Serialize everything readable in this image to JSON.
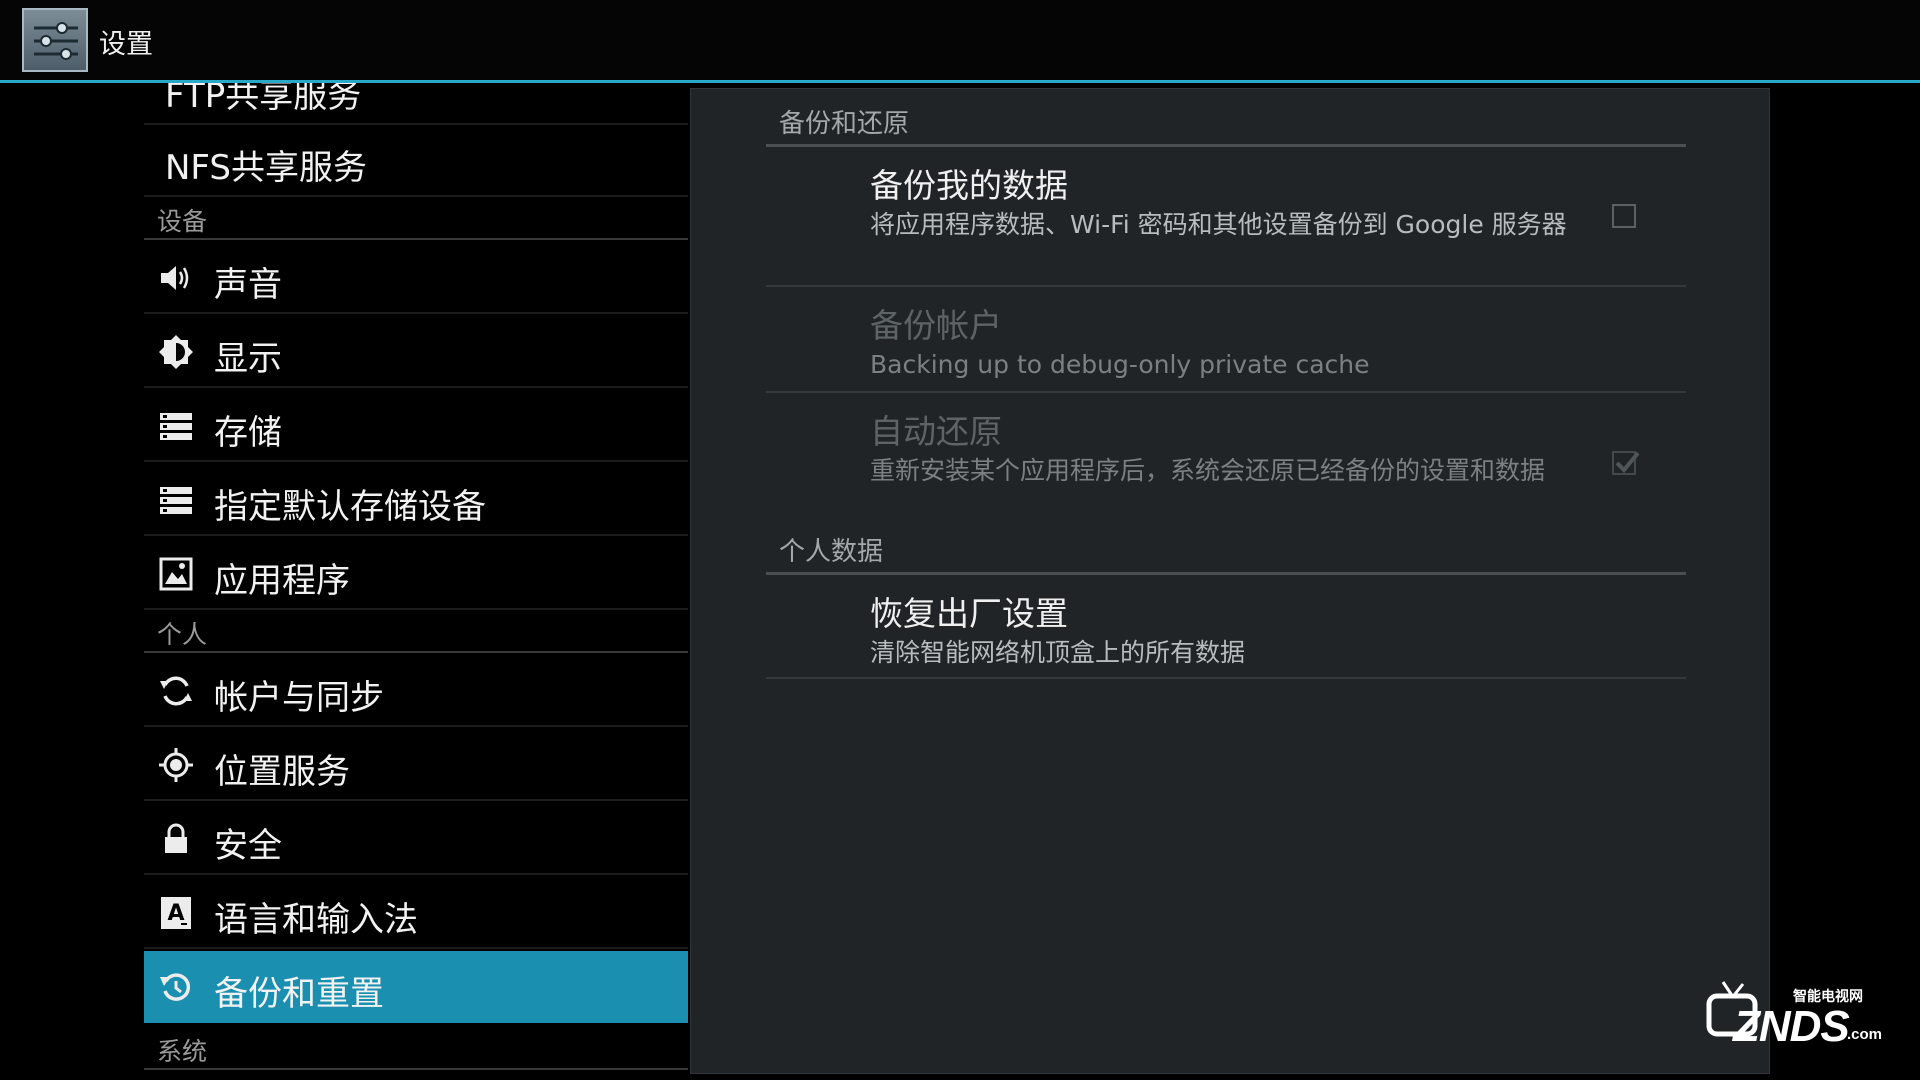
{
  "actionbar": {
    "title": "设置",
    "app_icon": "settings-sliders-icon"
  },
  "sidebar": {
    "rows": [
      {
        "type": "item",
        "label": "FTP共享服务",
        "icon": null
      },
      {
        "type": "item",
        "label": "NFS共享服务",
        "icon": null
      },
      {
        "type": "category",
        "label": "设备"
      },
      {
        "type": "item",
        "label": "声音",
        "icon": "speaker-icon"
      },
      {
        "type": "item",
        "label": "显示",
        "icon": "brightness-icon"
      },
      {
        "type": "item",
        "label": "存储",
        "icon": "storage-icon"
      },
      {
        "type": "item",
        "label": "指定默认存储设备",
        "icon": "storage-icon"
      },
      {
        "type": "item",
        "label": "应用程序",
        "icon": "apps-icon"
      },
      {
        "type": "category",
        "label": "个人"
      },
      {
        "type": "item",
        "label": "帐户与同步",
        "icon": "sync-icon"
      },
      {
        "type": "item",
        "label": "位置服务",
        "icon": "location-icon"
      },
      {
        "type": "item",
        "label": "安全",
        "icon": "lock-icon"
      },
      {
        "type": "item",
        "label": "语言和输入法",
        "icon": "keyboard-icon"
      },
      {
        "type": "item",
        "label": "备份和重置",
        "icon": "backup-restore-icon",
        "selected": true
      },
      {
        "type": "category",
        "label": "系统"
      }
    ]
  },
  "detail": {
    "section_backup": "备份和还原",
    "backup_data": {
      "title": "备份我的数据",
      "summary": "将应用程序数据、Wi-Fi 密码和其他设置备份到 Google 服务器",
      "checked": false
    },
    "backup_account": {
      "title": "备份帐户",
      "summary": "Backing up to debug-only private cache",
      "enabled": false
    },
    "auto_restore": {
      "title": "自动还原",
      "summary": "重新安装某个应用程序后，系统会还原已经备份的设置和数据",
      "checked": true,
      "enabled": false
    },
    "section_personal": "个人数据",
    "factory_reset": {
      "title": "恢复出厂设置",
      "summary": "清除智能网络机顶盒上的所有数据"
    }
  },
  "watermark": {
    "top": "智能电视网",
    "brand": "ZNDS",
    "suffix": ".com"
  },
  "colors": {
    "accent": "#1a8fb0",
    "actionbar_line": "#2aa8c8",
    "pane_bg": "#202426"
  }
}
